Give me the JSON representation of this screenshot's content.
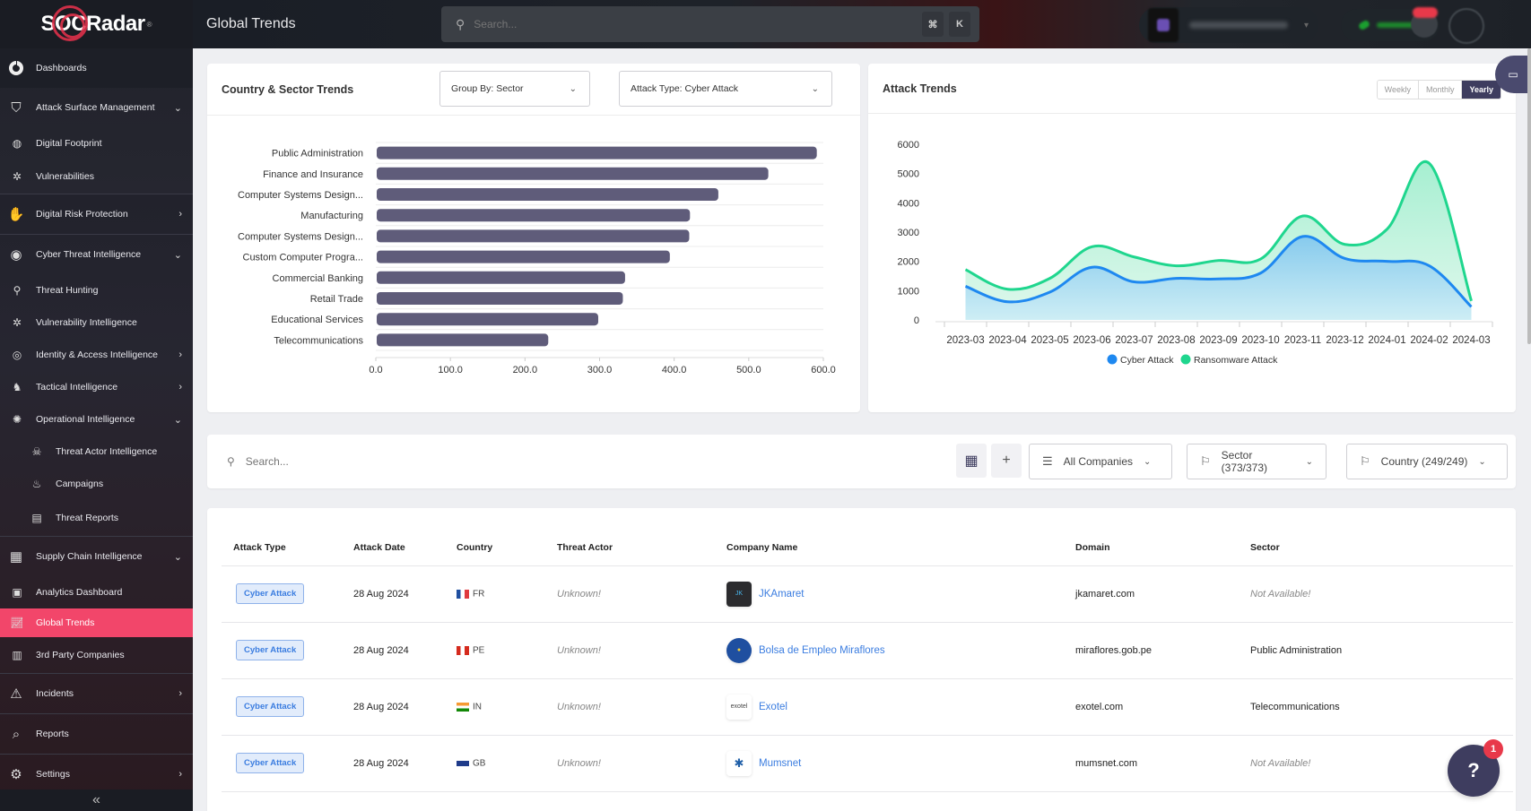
{
  "app": {
    "brand": "SOCRadar",
    "page_title": "Global Trends"
  },
  "topbar": {
    "search_placeholder": "Search...",
    "shortcut_keys": [
      "⌘",
      "K"
    ]
  },
  "sidebar": {
    "items": [
      {
        "label": "Dashboards",
        "icon": "dashboard-icon",
        "level": 0
      },
      {
        "label": "Attack Surface Management",
        "icon": "shield-scan-icon",
        "level": 0,
        "expanded": true
      },
      {
        "label": "Digital Footprint",
        "icon": "globe-icon",
        "level": 1
      },
      {
        "label": "Vulnerabilities",
        "icon": "bug-icon",
        "level": 1
      },
      {
        "label": "Digital Risk Protection",
        "icon": "hand-shield-icon",
        "level": 0,
        "expanded": false
      },
      {
        "label": "Cyber Threat Intelligence",
        "icon": "eye-shield-icon",
        "level": 0,
        "expanded": true
      },
      {
        "label": "Threat Hunting",
        "icon": "search-icon",
        "level": 1
      },
      {
        "label": "Vulnerability Intelligence",
        "icon": "bug-icon",
        "level": 1
      },
      {
        "label": "Identity & Access Intelligence",
        "icon": "fingerprint-icon",
        "level": 1,
        "expanded": false
      },
      {
        "label": "Tactical Intelligence",
        "icon": "chess-knight-icon",
        "level": 1,
        "expanded": false
      },
      {
        "label": "Operational Intelligence",
        "icon": "virus-icon",
        "level": 1,
        "expanded": true
      },
      {
        "label": "Threat Actor Intelligence",
        "icon": "hacker-icon",
        "level": 2
      },
      {
        "label": "Campaigns",
        "icon": "flame-icon",
        "level": 2
      },
      {
        "label": "Threat Reports",
        "icon": "report-icon",
        "level": 2
      },
      {
        "label": "Supply Chain Intelligence",
        "icon": "buildings-icon",
        "level": 0,
        "expanded": true
      },
      {
        "label": "Analytics Dashboard",
        "icon": "analytics-icon",
        "level": 1
      },
      {
        "label": "Global Trends",
        "icon": "trend-chart-icon",
        "level": 1,
        "active": true
      },
      {
        "label": "3rd Party Companies",
        "icon": "building-icon",
        "level": 1
      },
      {
        "label": "Incidents",
        "icon": "alert-monitor-icon",
        "level": 0,
        "expanded": false
      },
      {
        "label": "Reports",
        "icon": "report-search-icon",
        "level": 0
      },
      {
        "label": "Settings",
        "icon": "gears-icon",
        "level": 0,
        "expanded": false
      }
    ],
    "collapse_glyph": "«"
  },
  "sector_card": {
    "title": "Country & Sector Trends",
    "group_by": "Group By: Sector",
    "attack_type": "Attack Type: Cyber Attack"
  },
  "trends_card": {
    "title": "Attack Trends",
    "periods": [
      "Weekly",
      "Monthly",
      "Yearly"
    ],
    "active_period": "Yearly"
  },
  "chart_data": [
    {
      "type": "bar",
      "orientation": "horizontal",
      "title": "Country & Sector Trends",
      "categories": [
        "Public Administration",
        "Finance and Insurance",
        "Computer Systems Design...",
        "Manufacturing",
        "Computer Systems Design...",
        "Custom Computer Progra...",
        "Commercial Banking",
        "Retail Trade",
        "Educational Services",
        "Telecommunications"
      ],
      "values": [
        590,
        525,
        458,
        420,
        419,
        393,
        333,
        330,
        297,
        230
      ],
      "xlim": [
        0,
        600
      ],
      "xticks": [
        "0.0",
        "100.0",
        "200.0",
        "300.0",
        "400.0",
        "500.0",
        "600.0"
      ],
      "color": "#5f5c7a",
      "grid": true
    },
    {
      "type": "area",
      "stacked": true,
      "title": "Attack Trends",
      "x": [
        "2023-03",
        "2023-04",
        "2023-05",
        "2023-06",
        "2023-07",
        "2023-08",
        "2023-09",
        "2023-10",
        "2023-11",
        "2023-12",
        "2024-01",
        "2024-02",
        "2024-03"
      ],
      "series": [
        {
          "name": "Cyber Attack",
          "color": "#1e88f0",
          "values": [
            1150,
            620,
            950,
            1800,
            1300,
            1420,
            1400,
            1600,
            2850,
            2100,
            2000,
            1850,
            450
          ]
        },
        {
          "name": "Ransomware Attack",
          "color": "#1fd68e",
          "values": [
            570,
            430,
            470,
            700,
            850,
            430,
            630,
            480,
            700,
            480,
            1100,
            3500,
            200
          ]
        }
      ],
      "ylim": [
        0,
        6000
      ],
      "yticks": [
        "0",
        "1000",
        "2000",
        "3000",
        "4000",
        "5000",
        "6000"
      ],
      "legend": "bottom-center"
    }
  ],
  "filters": {
    "search_placeholder": "Search...",
    "companies": "All Companies",
    "sector": "Sector (373/373)",
    "country": "Country (249/249)"
  },
  "table": {
    "columns": [
      "Attack Type",
      "Attack Date",
      "Country",
      "Threat Actor",
      "Company Name",
      "Domain",
      "Sector"
    ],
    "rows": [
      {
        "attack_type": "Cyber Attack",
        "date": "28 Aug 2024",
        "country": "FR",
        "actor": "Unknown!",
        "company": "JKAmaret",
        "domain": "jkamaret.com",
        "sector": "Not Available!",
        "sector_missing": true
      },
      {
        "attack_type": "Cyber Attack",
        "date": "28 Aug 2024",
        "country": "PE",
        "actor": "Unknown!",
        "company": "Bolsa de Empleo Miraflores",
        "domain": "miraflores.gob.pe",
        "sector": "Public Administration",
        "sector_missing": false
      },
      {
        "attack_type": "Cyber Attack",
        "date": "28 Aug 2024",
        "country": "IN",
        "actor": "Unknown!",
        "company": "Exotel",
        "domain": "exotel.com",
        "sector": "Telecommunications",
        "sector_missing": false
      },
      {
        "attack_type": "Cyber Attack",
        "date": "28 Aug 2024",
        "country": "GB",
        "actor": "Unknown!",
        "company": "Mumsnet",
        "domain": "mumsnet.com",
        "sector": "Not Available!",
        "sector_missing": true
      }
    ]
  },
  "help_widget": {
    "badge_count": "1",
    "glyph": "?"
  }
}
